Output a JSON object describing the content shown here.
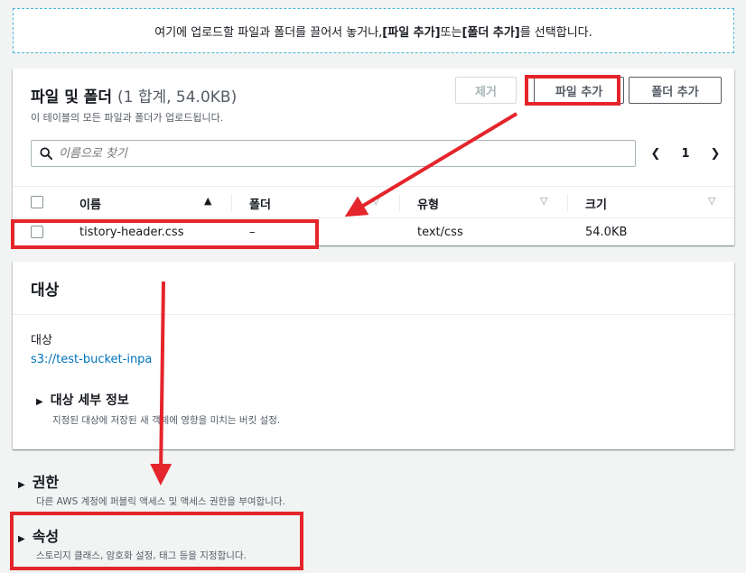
{
  "dropzone": {
    "text_before": "여기에 업로드할 파일과 폴더를 끌어서 놓거나, ",
    "bold1": "[파일 추가]",
    "text_mid": " 또는 ",
    "bold2": "[폴더 추가]",
    "text_after": "를 선택합니다."
  },
  "files": {
    "title": "파일 및 폴더",
    "count": "(1 합계, 54.0KB)",
    "description": "이 테이블의 모든 파일과 폴더가 업로드됩니다.",
    "remove_label": "제거",
    "add_file_label": "파일 추가",
    "add_folder_label": "폴더 추가",
    "search_placeholder": "이름으로 찾기",
    "page_number": "1",
    "prev_label": "❮",
    "next_label": "❯",
    "columns": [
      {
        "label": "이름",
        "sort": "▲"
      },
      {
        "label": "폴더",
        "sort": "▽"
      },
      {
        "label": "유형",
        "sort": "▽"
      },
      {
        "label": "크기",
        "sort": "▽"
      }
    ],
    "rows": [
      {
        "name": "tistory-header.css",
        "folder": "–",
        "type": "text/css",
        "size": "54.0KB"
      }
    ]
  },
  "target": {
    "title": "대상",
    "label": "대상",
    "link": "s3://test-bucket-inpa",
    "details_title": "대상 세부 정보",
    "details_desc": "지정된 대상에 저장된 새 객체에 영향을 미치는 버킷 설정."
  },
  "permissions": {
    "title": "권한",
    "desc": "다른 AWS 계정에 퍼블릭 액세스 및 액세스 권한을 부여합니다."
  },
  "properties": {
    "title": "속성",
    "desc": "스토리지 클래스, 암호화 설정, 태그 등을 지정합니다."
  },
  "expander_glyph": "▶",
  "colors": {
    "annotation": "#e4252b",
    "link": "#0073bb",
    "dropzone_border": "#44b9d6"
  },
  "icons": [
    "search-icon",
    "caret-right-icon",
    "sort-up-icon",
    "sort-down-icon",
    "chevron-left-icon",
    "chevron-right-icon"
  ]
}
